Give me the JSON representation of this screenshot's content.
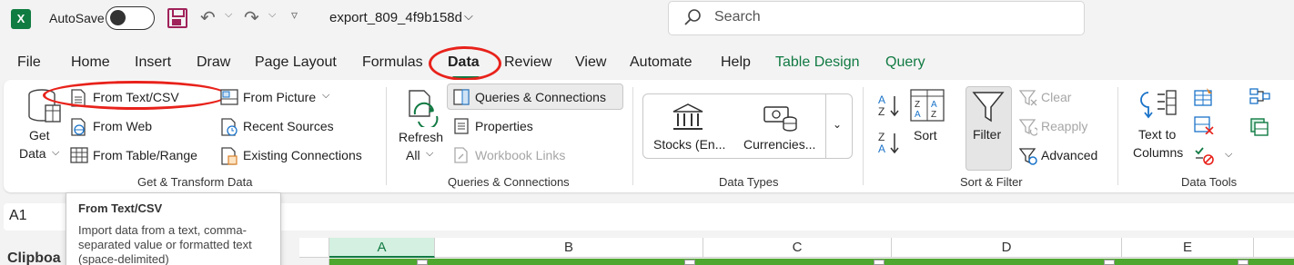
{
  "titlebar": {
    "app_icon": "excel-logo",
    "autosave_label": "AutoSave",
    "filename": "export_809_4f9b158d",
    "search_placeholder": "Search"
  },
  "tabs": [
    {
      "label": "File"
    },
    {
      "label": "Home"
    },
    {
      "label": "Insert"
    },
    {
      "label": "Draw"
    },
    {
      "label": "Page Layout"
    },
    {
      "label": "Formulas"
    },
    {
      "label": "Data",
      "active": true
    },
    {
      "label": "Review"
    },
    {
      "label": "View"
    },
    {
      "label": "Automate"
    },
    {
      "label": "Help"
    },
    {
      "label": "Table Design",
      "contextual": true
    },
    {
      "label": "Query",
      "contextual": true
    }
  ],
  "ribbon": {
    "get_transform": {
      "get_data_line1": "Get",
      "get_data_line2": "Data",
      "from_text_csv": "From Text/CSV",
      "from_web": "From Web",
      "from_table_range": "From Table/Range",
      "from_picture": "From Picture",
      "recent_sources": "Recent Sources",
      "existing_connections": "Existing Connections",
      "group_label": "Get & Transform Data"
    },
    "queries": {
      "refresh_line1": "Refresh",
      "refresh_line2": "All",
      "queries_connections": "Queries & Connections",
      "properties": "Properties",
      "workbook_links": "Workbook Links",
      "group_label": "Queries & Connections"
    },
    "data_types": {
      "stocks": "Stocks (En...",
      "currencies": "Currencies...",
      "group_label": "Data Types"
    },
    "sort_filter": {
      "sort": "Sort",
      "filter": "Filter",
      "clear": "Clear",
      "reapply": "Reapply",
      "advanced": "Advanced",
      "group_label": "Sort & Filter"
    },
    "data_tools": {
      "text_to_columns_line1": "Text to",
      "text_to_columns_line2": "Columns",
      "group_label": "Data Tools"
    }
  },
  "namebox": {
    "value": "A1"
  },
  "grid": {
    "clipboard_peek": "Clipboa",
    "columns": [
      "A",
      "B",
      "C",
      "D",
      "E"
    ]
  },
  "tooltip": {
    "title": "From Text/CSV",
    "body": "Import data from a text, comma-separated value or formatted text (space-delimited)"
  },
  "colors": {
    "accent_green": "#117a43",
    "table_header_green": "#4ea72e",
    "annotation_red": "#e8221b"
  }
}
